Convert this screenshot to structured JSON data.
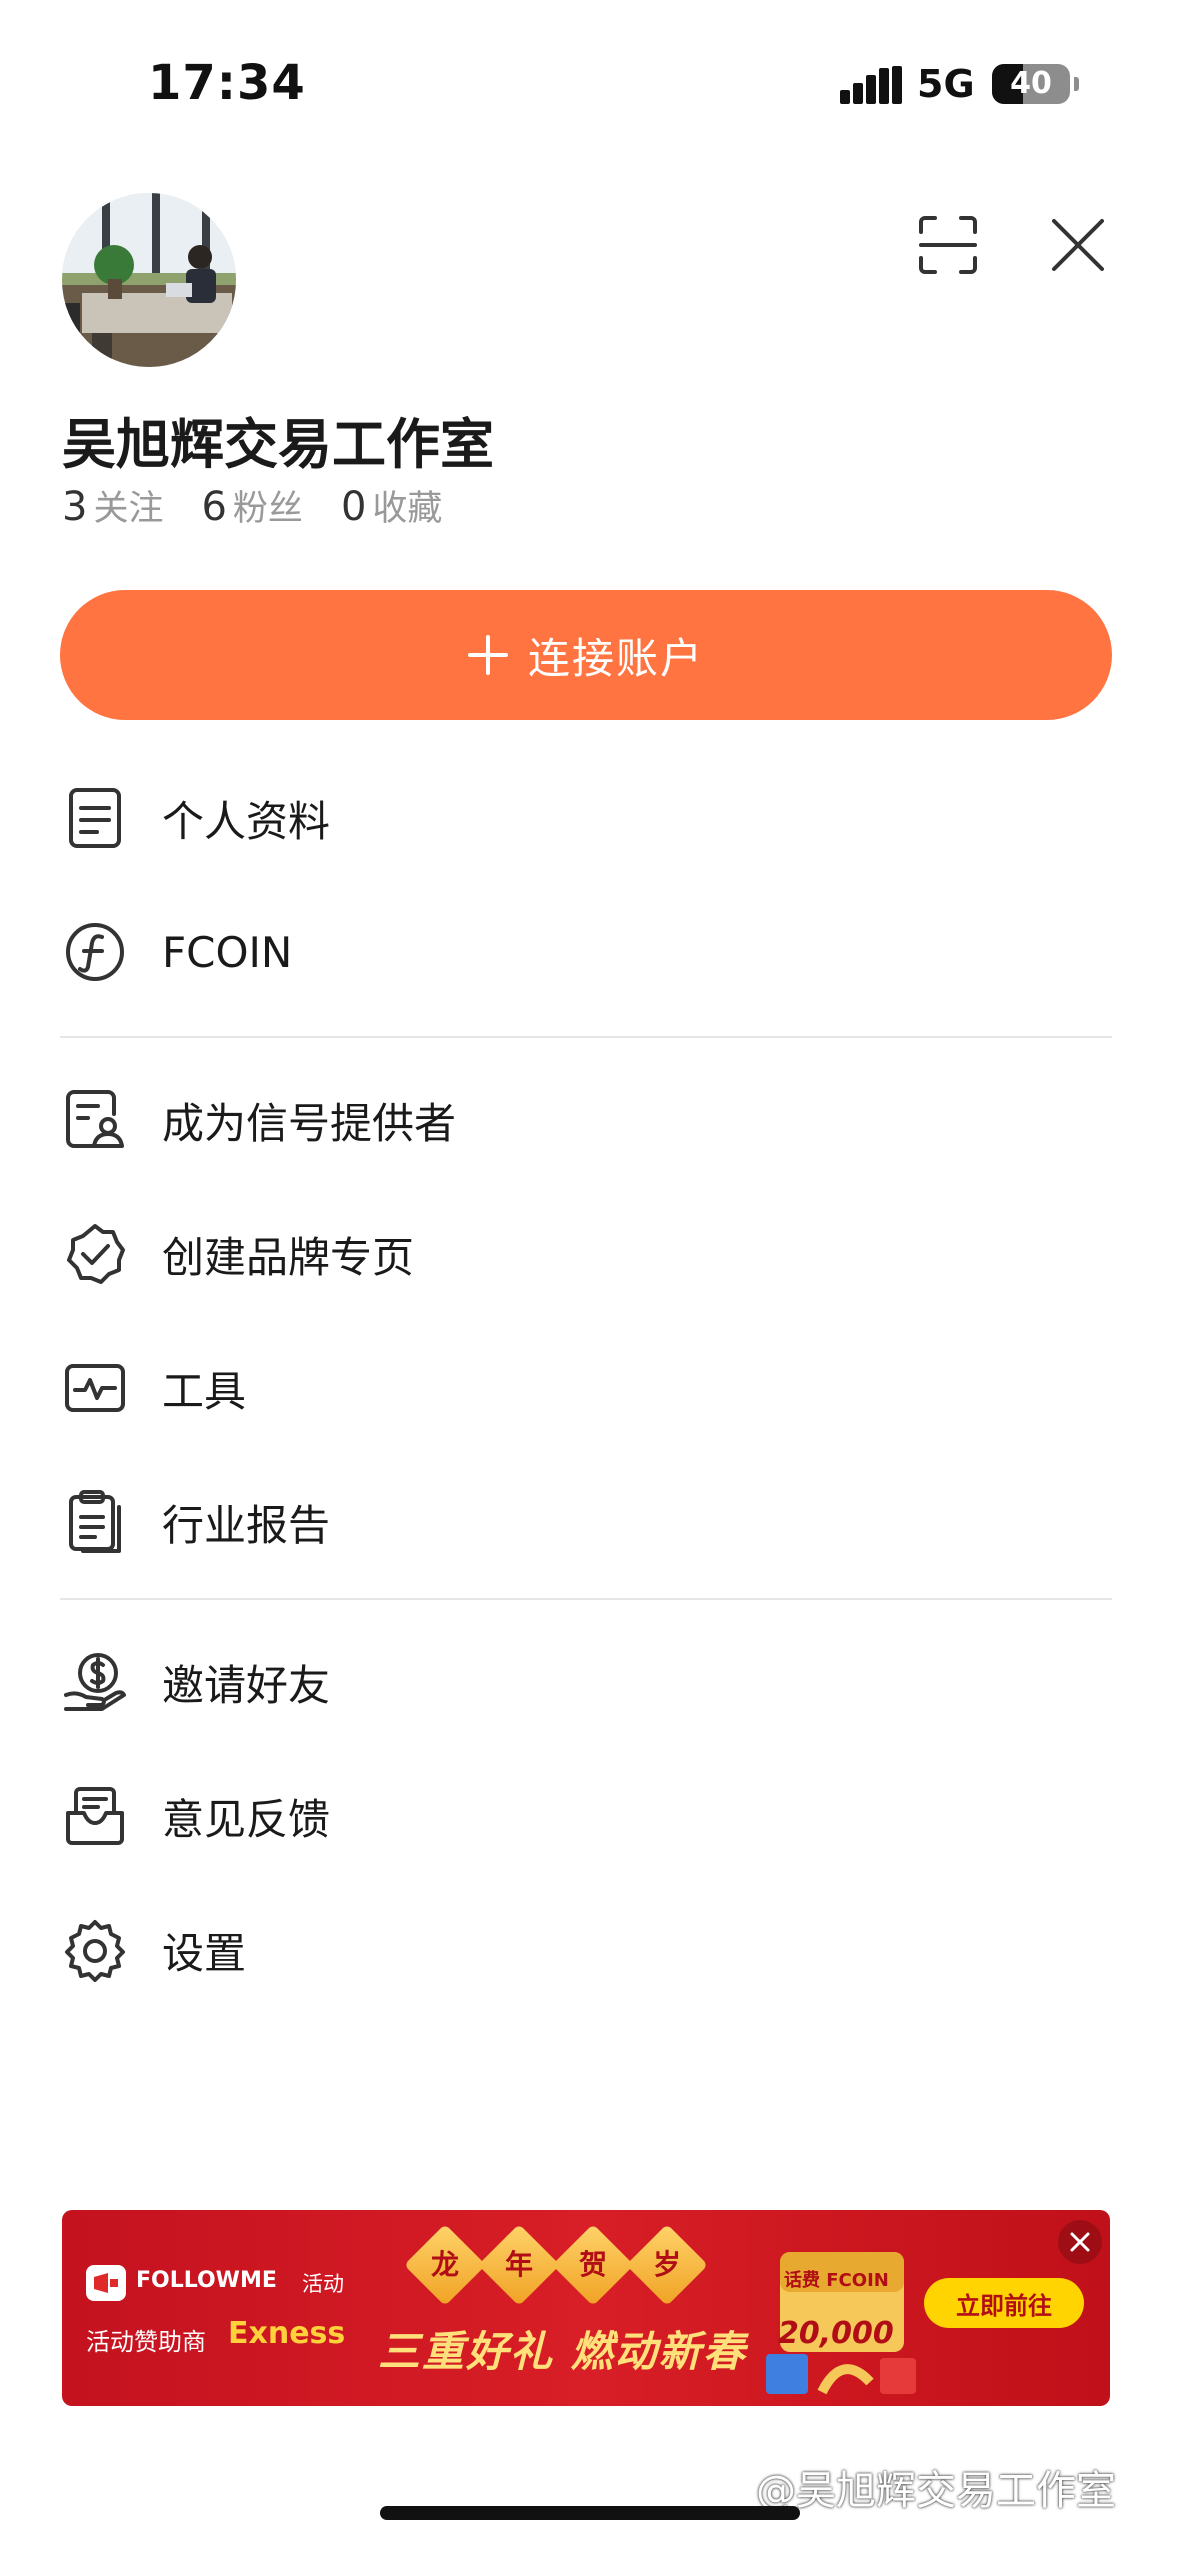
{
  "status_bar": {
    "time": "17:34",
    "network": "5G",
    "battery": "40",
    "battery_level": 0.4
  },
  "header": {
    "user_name": "吴旭辉交易工作室",
    "stats": [
      {
        "value": "3",
        "label": "关注"
      },
      {
        "value": "6",
        "label": "粉丝"
      },
      {
        "value": "0",
        "label": "收藏"
      }
    ],
    "scan_icon": "scan-icon",
    "close_icon": "close-icon"
  },
  "connect_button": {
    "label": "连接账户",
    "color": "#ff7440"
  },
  "menu": {
    "group1": [
      {
        "label": "个人资料",
        "icon": "document-icon"
      },
      {
        "label": "FCOIN",
        "icon": "fcoin-icon"
      }
    ],
    "group2": [
      {
        "label": "成为信号提供者",
        "icon": "signal-provider-icon"
      },
      {
        "label": "创建品牌专页",
        "icon": "verified-badge-icon"
      },
      {
        "label": "工具",
        "icon": "pulse-tool-icon"
      },
      {
        "label": "行业报告",
        "icon": "clipboard-report-icon"
      }
    ],
    "group3": [
      {
        "label": "邀请好友",
        "icon": "invite-money-icon"
      },
      {
        "label": "意见反馈",
        "icon": "feedback-inbox-icon"
      },
      {
        "label": "设置",
        "icon": "gear-icon"
      }
    ]
  },
  "banner": {
    "logo_text": "FOLLOWME",
    "activity": "活动",
    "sponsor_label": "活动赞助商",
    "sponsor_brand": "Exness",
    "diamond_chars": [
      "龙",
      "年",
      "贺",
      "岁"
    ],
    "slogan": "三重好礼 燃动新春",
    "gift_tag": "话费 FCOIN",
    "amount": "20,000",
    "cta": "立即前往",
    "colors": {
      "background": "#d81e26",
      "cta": "#ffd400",
      "slogan": "#ffe07a"
    }
  },
  "watermark": "@吴旭辉交易工作室"
}
